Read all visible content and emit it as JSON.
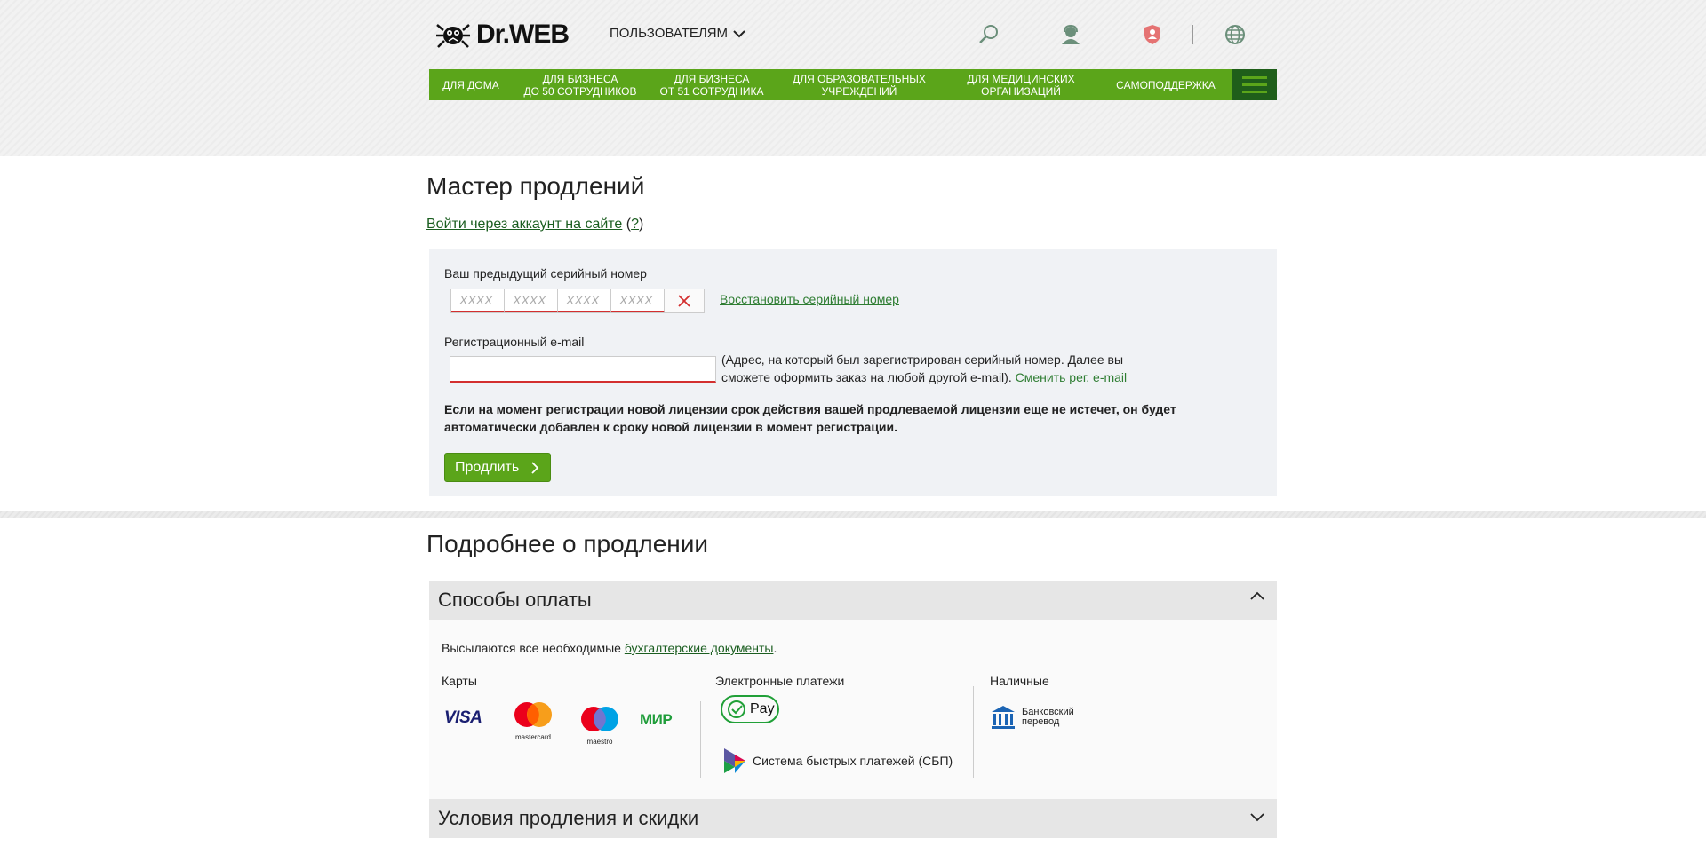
{
  "header": {
    "logo_text": "Dr.WEB",
    "users_label": "ПОЛЬЗОВАТЕЛЯМ",
    "icons": [
      "search-icon",
      "support-icon",
      "shield-user-icon",
      "globe-icon"
    ],
    "nav": [
      {
        "line1": "ДЛЯ ДОМА",
        "line2": ""
      },
      {
        "line1": "ДЛЯ БИЗНЕСА",
        "line2": "ДО 50 СОТРУДНИКОВ"
      },
      {
        "line1": "ДЛЯ БИЗНЕСА",
        "line2": "ОТ 51 СОТРУДНИКА"
      },
      {
        "line1": "ДЛЯ ОБРАЗОВАТЕЛЬНЫХ",
        "line2": "УЧРЕЖДЕНИЙ"
      },
      {
        "line1": "ДЛЯ МЕДИЦИНСКИХ",
        "line2": "ОРГАНИЗАЦИЙ"
      },
      {
        "line1": "САМОПОДДЕРЖКА",
        "line2": ""
      }
    ],
    "accent": "#5ba51a",
    "menu_bg": "#1f5e1a"
  },
  "page": {
    "title": "Мастер продлений",
    "login_link": "Войти через аккаунт на сайте",
    "login_help": "?"
  },
  "form": {
    "serial_label": "Ваш предыдущий серийный номер",
    "serial_placeholder": "XXXX",
    "restore_link": "Восстановить серийный номер",
    "email_label": "Регистрационный e-mail",
    "email_value": "",
    "email_note": "(Адрес, на который был зарегистрирован серийный номер. Далее вы сможете оформить заказ на любой другой e-mail).",
    "change_email_link": "Сменить рег. e-mail",
    "notice": "Если на момент регистрации новой лицензии срок действия вашей продлеваемой лицензии еще не истечет, он будет автоматически добавлен к сроку новой лицензии в момент регистрации.",
    "submit_label": "Продлить"
  },
  "details": {
    "title": "Подробнее о продлении",
    "payment": {
      "header": "Способы оплаты",
      "sent_prefix": "Высылаются все необходимые",
      "docs_link": "бухгалтерские документы",
      "cards_title": "Карты",
      "cards": {
        "visa": "VISA",
        "mastercard": "mastercard",
        "maestro": "maestro",
        "mir": "МИР"
      },
      "electronic_title": "Электронные платежи",
      "pay_label": "Pay",
      "sbp_label": "Система быстрых платежей (СБП)",
      "cash_title": "Наличные",
      "bank_line1": "Банковский",
      "bank_line2": "перевод"
    },
    "terms_header": "Условия продления и скидки"
  }
}
